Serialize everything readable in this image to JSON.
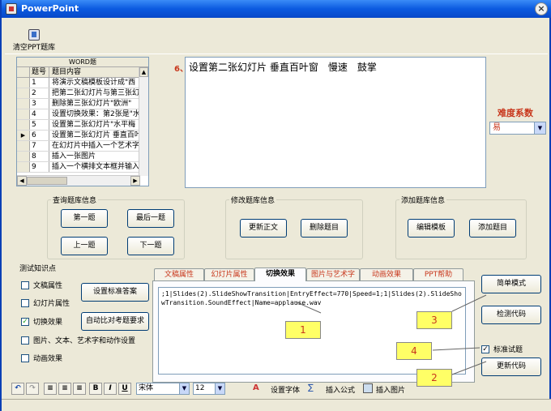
{
  "window": {
    "title": "PowerPoint",
    "close_glyph": "×"
  },
  "toolbar": {
    "clear_label": "清空PPT题库",
    "clear_icon": "database-icon"
  },
  "grid": {
    "caption": "WORD题",
    "col_no": "题号",
    "col_content": "题目内容",
    "rows": [
      {
        "no": "1",
        "text": "将演示文稿模板设计成\"西"
      },
      {
        "no": "2",
        "text": "把第二张幻灯片与第三张幻"
      },
      {
        "no": "3",
        "text": "删除第三张幻灯片\"欧洲\""
      },
      {
        "no": "4",
        "text": "设置切换效果：第2张是\"水"
      },
      {
        "no": "5",
        "text": "设置第二张幻灯片\"水平梅"
      },
      {
        "no": "6",
        "text": "设置第二张幻灯片 垂直百叶"
      },
      {
        "no": "7",
        "text": "在幻灯片中插入一个艺术字"
      },
      {
        "no": "8",
        "text": "插入一张图片"
      },
      {
        "no": "9",
        "text": "插入一个横排文本框并输入"
      }
    ],
    "current_row_marker": "▶"
  },
  "question": {
    "number": "6、",
    "text": "设置第二张幻灯片 垂直百叶窗　慢速　鼓掌"
  },
  "difficulty": {
    "label": "难度系数",
    "value": "易"
  },
  "query_group": {
    "legend": "查询题库信息",
    "first": "第一题",
    "last": "最后一题",
    "prev": "上一题",
    "next": "下一题"
  },
  "modify_group": {
    "legend": "修改题库信息",
    "update_body": "更新正文",
    "delete": "删除题目"
  },
  "add_group": {
    "legend": "添加题库信息",
    "edit_template": "编辑模板",
    "add": "添加题目"
  },
  "knowledge": {
    "legend": "测试知识点",
    "items": [
      {
        "label": "文稿属性",
        "checked": false
      },
      {
        "label": "幻灯片属性",
        "checked": false
      },
      {
        "label": "切换效果",
        "checked": true
      },
      {
        "label": "图片、文本、艺术字和动作设置",
        "checked": false
      },
      {
        "label": "动画效果",
        "checked": false
      }
    ],
    "set_answer": "设置标准答案",
    "auto_compare": "自动比对考题要求"
  },
  "tabs": {
    "items": [
      "文稿属性",
      "幻灯片属性",
      "切换效果",
      "图片与艺术字",
      "动画效果",
      "PPT帮助"
    ],
    "active": 2,
    "code": ";1|Slides(2).SlideShowTransition|EntryEffect=770|Speed=1;1|Slides(2).SlideShowTransition.SoundEffect|Name=applause.wav"
  },
  "right_panel": {
    "simple_mode": "简单模式",
    "check_code": "检测代码",
    "standard_label": "标准试题",
    "standard_checked": true,
    "update_code": "更新代码"
  },
  "callouts": [
    "1",
    "2",
    "3",
    "4"
  ],
  "bottom": {
    "font_name": "宋体",
    "font_size": "12",
    "set_font": "设置字体",
    "insert_formula": "插入公式",
    "insert_image": "插入图片",
    "bold": "B",
    "italic": "I",
    "underline": "U"
  },
  "colors": {
    "accent_red": "#c8371c",
    "titlebar_blue": "#0b5ae0",
    "callout_yellow": "#ffff66"
  }
}
